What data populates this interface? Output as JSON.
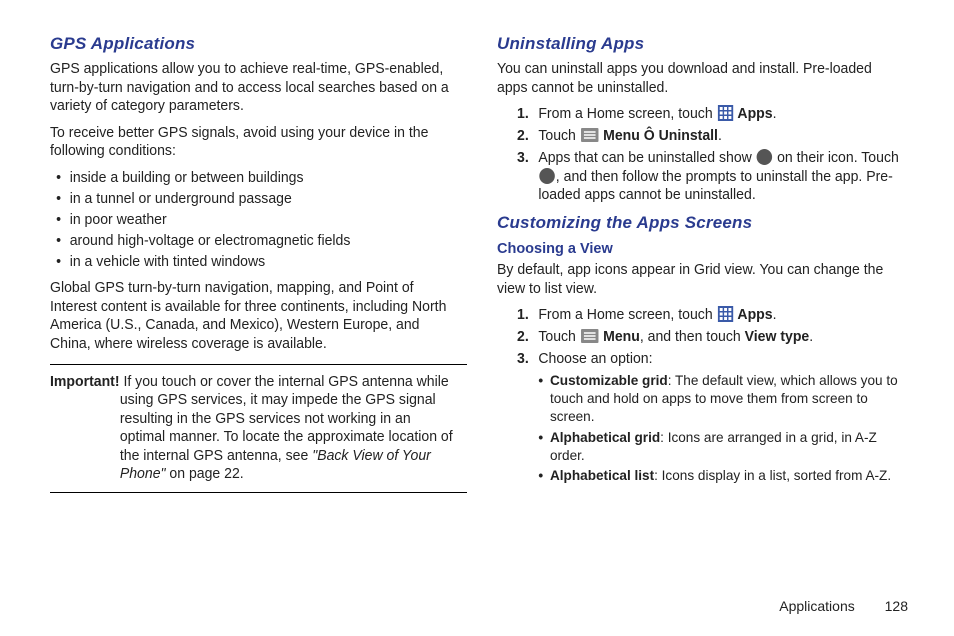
{
  "left": {
    "h1": "GPS Applications",
    "p1": "GPS applications allow you to achieve real-time, GPS-enabled, turn-by-turn navigation and to access local searches based on a variety of category parameters.",
    "p2": "To receive better GPS signals, avoid using your device in the following conditions:",
    "bullets": [
      "inside a building or between buildings",
      "in a tunnel or underground passage",
      "in poor weather",
      "around high-voltage or electromagnetic fields",
      "in a vehicle with tinted windows"
    ],
    "p3": "Global GPS turn-by-turn navigation, mapping, and Point of Interest content is available for three continents, including North America (U.S., Canada, and Mexico), Western Europe, and China, where wireless coverage is available.",
    "important_label": "Important!",
    "important_text": " If you touch or cover the internal GPS antenna while using GPS services, it may impede the GPS signal resulting in the GPS services not working in an optimal manner. To locate the approximate location of the internal GPS antenna, see ",
    "important_ref": "\"Back View of Your Phone\"",
    "important_tail": " on page 22."
  },
  "right": {
    "h1": "Uninstalling Apps",
    "p1": "You can uninstall apps you download and install. Pre-loaded apps cannot be uninstalled.",
    "s1a": "From a Home screen, touch ",
    "s1b": " Apps",
    "s1c": ".",
    "s2a": "Touch ",
    "s2b": " Menu Ô Uninstall",
    "s2c": ".",
    "s3a": "Apps that can be uninstalled show ",
    "s3b": " on their icon. Touch ",
    "s3c": ", and then follow the prompts to uninstall the app. Pre-loaded apps cannot be uninstalled.",
    "h2": "Customizing the Apps Screens",
    "h3": "Choosing a View",
    "p2": "By default, app icons appear in Grid view. You can change the view to list view.",
    "c1a": "From a Home screen, touch ",
    "c1b": " Apps",
    "c1c": ".",
    "c2a": "Touch ",
    "c2b": " Menu",
    "c2c": ", and then touch ",
    "c2d": "View type",
    "c2e": ".",
    "c3": "Choose an option:",
    "opt1_label": "Customizable grid",
    "opt1_text": ": The default view, which allows you to touch and hold on apps to move them from screen to screen.",
    "opt2_label": "Alphabetical grid",
    "opt2_text": ": Icons are arranged in a grid, in A-Z order.",
    "opt3_label": "Alphabetical list",
    "opt3_text": ": Icons display in a list, sorted from A-Z."
  },
  "footer": {
    "section": "Applications",
    "page": "128"
  },
  "icons": {
    "apps": "apps-grid-icon",
    "menu": "menu-icon",
    "circle": "remove-circle-icon"
  }
}
